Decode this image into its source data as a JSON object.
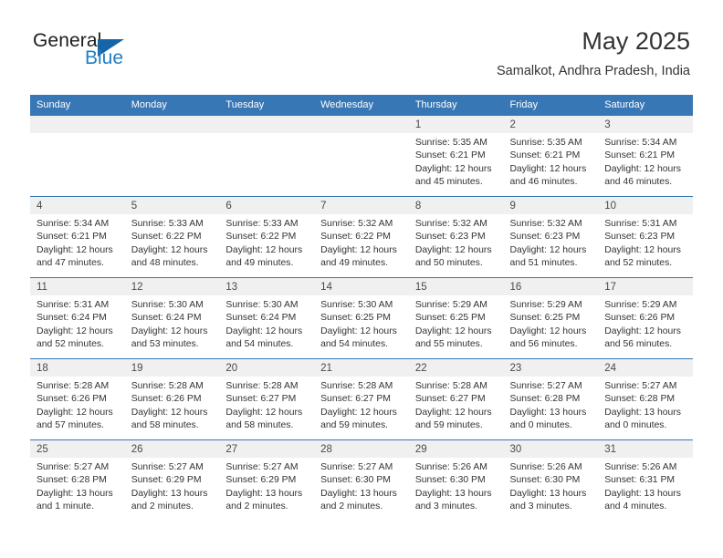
{
  "brand": {
    "name_part1": "General",
    "name_part2": "Blue",
    "logo_icon": "blue-triangle-icon"
  },
  "header": {
    "month_title": "May 2025",
    "location": "Samalkot, Andhra Pradesh, India"
  },
  "calendar": {
    "weekday_headers": [
      "Sunday",
      "Monday",
      "Tuesday",
      "Wednesday",
      "Thursday",
      "Friday",
      "Saturday"
    ],
    "accent_color": "#3877b5",
    "daynum_band_color": "#f0f0f0",
    "weeks": [
      [
        {
          "day": "",
          "empty": true,
          "sunrise": "",
          "sunset": "",
          "daylight_line1": "",
          "daylight_line2": ""
        },
        {
          "day": "",
          "empty": true,
          "sunrise": "",
          "sunset": "",
          "daylight_line1": "",
          "daylight_line2": ""
        },
        {
          "day": "",
          "empty": true,
          "sunrise": "",
          "sunset": "",
          "daylight_line1": "",
          "daylight_line2": ""
        },
        {
          "day": "",
          "empty": true,
          "sunrise": "",
          "sunset": "",
          "daylight_line1": "",
          "daylight_line2": ""
        },
        {
          "day": "1",
          "empty": false,
          "sunrise": "Sunrise: 5:35 AM",
          "sunset": "Sunset: 6:21 PM",
          "daylight_line1": "Daylight: 12 hours",
          "daylight_line2": "and 45 minutes."
        },
        {
          "day": "2",
          "empty": false,
          "sunrise": "Sunrise: 5:35 AM",
          "sunset": "Sunset: 6:21 PM",
          "daylight_line1": "Daylight: 12 hours",
          "daylight_line2": "and 46 minutes."
        },
        {
          "day": "3",
          "empty": false,
          "sunrise": "Sunrise: 5:34 AM",
          "sunset": "Sunset: 6:21 PM",
          "daylight_line1": "Daylight: 12 hours",
          "daylight_line2": "and 46 minutes."
        }
      ],
      [
        {
          "day": "4",
          "empty": false,
          "sunrise": "Sunrise: 5:34 AM",
          "sunset": "Sunset: 6:21 PM",
          "daylight_line1": "Daylight: 12 hours",
          "daylight_line2": "and 47 minutes."
        },
        {
          "day": "5",
          "empty": false,
          "sunrise": "Sunrise: 5:33 AM",
          "sunset": "Sunset: 6:22 PM",
          "daylight_line1": "Daylight: 12 hours",
          "daylight_line2": "and 48 minutes."
        },
        {
          "day": "6",
          "empty": false,
          "sunrise": "Sunrise: 5:33 AM",
          "sunset": "Sunset: 6:22 PM",
          "daylight_line1": "Daylight: 12 hours",
          "daylight_line2": "and 49 minutes."
        },
        {
          "day": "7",
          "empty": false,
          "sunrise": "Sunrise: 5:32 AM",
          "sunset": "Sunset: 6:22 PM",
          "daylight_line1": "Daylight: 12 hours",
          "daylight_line2": "and 49 minutes."
        },
        {
          "day": "8",
          "empty": false,
          "sunrise": "Sunrise: 5:32 AM",
          "sunset": "Sunset: 6:23 PM",
          "daylight_line1": "Daylight: 12 hours",
          "daylight_line2": "and 50 minutes."
        },
        {
          "day": "9",
          "empty": false,
          "sunrise": "Sunrise: 5:32 AM",
          "sunset": "Sunset: 6:23 PM",
          "daylight_line1": "Daylight: 12 hours",
          "daylight_line2": "and 51 minutes."
        },
        {
          "day": "10",
          "empty": false,
          "sunrise": "Sunrise: 5:31 AM",
          "sunset": "Sunset: 6:23 PM",
          "daylight_line1": "Daylight: 12 hours",
          "daylight_line2": "and 52 minutes."
        }
      ],
      [
        {
          "day": "11",
          "empty": false,
          "sunrise": "Sunrise: 5:31 AM",
          "sunset": "Sunset: 6:24 PM",
          "daylight_line1": "Daylight: 12 hours",
          "daylight_line2": "and 52 minutes."
        },
        {
          "day": "12",
          "empty": false,
          "sunrise": "Sunrise: 5:30 AM",
          "sunset": "Sunset: 6:24 PM",
          "daylight_line1": "Daylight: 12 hours",
          "daylight_line2": "and 53 minutes."
        },
        {
          "day": "13",
          "empty": false,
          "sunrise": "Sunrise: 5:30 AM",
          "sunset": "Sunset: 6:24 PM",
          "daylight_line1": "Daylight: 12 hours",
          "daylight_line2": "and 54 minutes."
        },
        {
          "day": "14",
          "empty": false,
          "sunrise": "Sunrise: 5:30 AM",
          "sunset": "Sunset: 6:25 PM",
          "daylight_line1": "Daylight: 12 hours",
          "daylight_line2": "and 54 minutes."
        },
        {
          "day": "15",
          "empty": false,
          "sunrise": "Sunrise: 5:29 AM",
          "sunset": "Sunset: 6:25 PM",
          "daylight_line1": "Daylight: 12 hours",
          "daylight_line2": "and 55 minutes."
        },
        {
          "day": "16",
          "empty": false,
          "sunrise": "Sunrise: 5:29 AM",
          "sunset": "Sunset: 6:25 PM",
          "daylight_line1": "Daylight: 12 hours",
          "daylight_line2": "and 56 minutes."
        },
        {
          "day": "17",
          "empty": false,
          "sunrise": "Sunrise: 5:29 AM",
          "sunset": "Sunset: 6:26 PM",
          "daylight_line1": "Daylight: 12 hours",
          "daylight_line2": "and 56 minutes."
        }
      ],
      [
        {
          "day": "18",
          "empty": false,
          "sunrise": "Sunrise: 5:28 AM",
          "sunset": "Sunset: 6:26 PM",
          "daylight_line1": "Daylight: 12 hours",
          "daylight_line2": "and 57 minutes."
        },
        {
          "day": "19",
          "empty": false,
          "sunrise": "Sunrise: 5:28 AM",
          "sunset": "Sunset: 6:26 PM",
          "daylight_line1": "Daylight: 12 hours",
          "daylight_line2": "and 58 minutes."
        },
        {
          "day": "20",
          "empty": false,
          "sunrise": "Sunrise: 5:28 AM",
          "sunset": "Sunset: 6:27 PM",
          "daylight_line1": "Daylight: 12 hours",
          "daylight_line2": "and 58 minutes."
        },
        {
          "day": "21",
          "empty": false,
          "sunrise": "Sunrise: 5:28 AM",
          "sunset": "Sunset: 6:27 PM",
          "daylight_line1": "Daylight: 12 hours",
          "daylight_line2": "and 59 minutes."
        },
        {
          "day": "22",
          "empty": false,
          "sunrise": "Sunrise: 5:28 AM",
          "sunset": "Sunset: 6:27 PM",
          "daylight_line1": "Daylight: 12 hours",
          "daylight_line2": "and 59 minutes."
        },
        {
          "day": "23",
          "empty": false,
          "sunrise": "Sunrise: 5:27 AM",
          "sunset": "Sunset: 6:28 PM",
          "daylight_line1": "Daylight: 13 hours",
          "daylight_line2": "and 0 minutes."
        },
        {
          "day": "24",
          "empty": false,
          "sunrise": "Sunrise: 5:27 AM",
          "sunset": "Sunset: 6:28 PM",
          "daylight_line1": "Daylight: 13 hours",
          "daylight_line2": "and 0 minutes."
        }
      ],
      [
        {
          "day": "25",
          "empty": false,
          "sunrise": "Sunrise: 5:27 AM",
          "sunset": "Sunset: 6:28 PM",
          "daylight_line1": "Daylight: 13 hours",
          "daylight_line2": "and 1 minute."
        },
        {
          "day": "26",
          "empty": false,
          "sunrise": "Sunrise: 5:27 AM",
          "sunset": "Sunset: 6:29 PM",
          "daylight_line1": "Daylight: 13 hours",
          "daylight_line2": "and 2 minutes."
        },
        {
          "day": "27",
          "empty": false,
          "sunrise": "Sunrise: 5:27 AM",
          "sunset": "Sunset: 6:29 PM",
          "daylight_line1": "Daylight: 13 hours",
          "daylight_line2": "and 2 minutes."
        },
        {
          "day": "28",
          "empty": false,
          "sunrise": "Sunrise: 5:27 AM",
          "sunset": "Sunset: 6:30 PM",
          "daylight_line1": "Daylight: 13 hours",
          "daylight_line2": "and 2 minutes."
        },
        {
          "day": "29",
          "empty": false,
          "sunrise": "Sunrise: 5:26 AM",
          "sunset": "Sunset: 6:30 PM",
          "daylight_line1": "Daylight: 13 hours",
          "daylight_line2": "and 3 minutes."
        },
        {
          "day": "30",
          "empty": false,
          "sunrise": "Sunrise: 5:26 AM",
          "sunset": "Sunset: 6:30 PM",
          "daylight_line1": "Daylight: 13 hours",
          "daylight_line2": "and 3 minutes."
        },
        {
          "day": "31",
          "empty": false,
          "sunrise": "Sunrise: 5:26 AM",
          "sunset": "Sunset: 6:31 PM",
          "daylight_line1": "Daylight: 13 hours",
          "daylight_line2": "and 4 minutes."
        }
      ]
    ]
  }
}
